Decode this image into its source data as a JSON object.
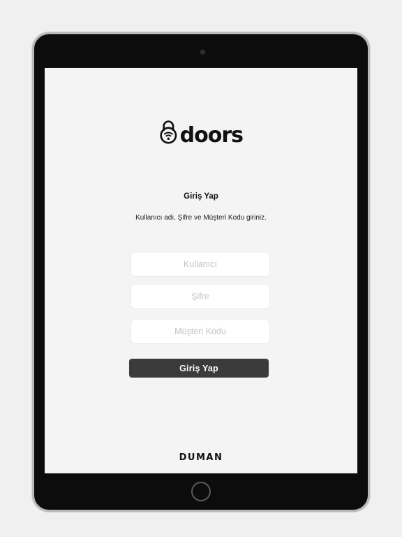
{
  "app": {
    "brand_name": "doors",
    "footer_brand": "DUMAN"
  },
  "login": {
    "title": "Giriş Yap",
    "subtitle": "Kullanıcı adı, Şifre ve Müşteri Kodu giriniz.",
    "fields": {
      "username_placeholder": "Kullanıcı",
      "password_placeholder": "Şifre",
      "customer_code_placeholder": "Müşteri Kodu"
    },
    "submit_label": "Giriş Yap"
  },
  "icons": {
    "logo": "lock-wifi-icon",
    "camera": "camera-icon",
    "home": "home-button"
  },
  "colors": {
    "background": "#f0f0f0",
    "screen_background": "#f4f4f4",
    "device_bezel": "#0c0c0c",
    "button_background": "#3b3b3b",
    "button_text": "#ffffff",
    "input_background": "#ffffff",
    "placeholder_text": "#c3c3c3"
  }
}
